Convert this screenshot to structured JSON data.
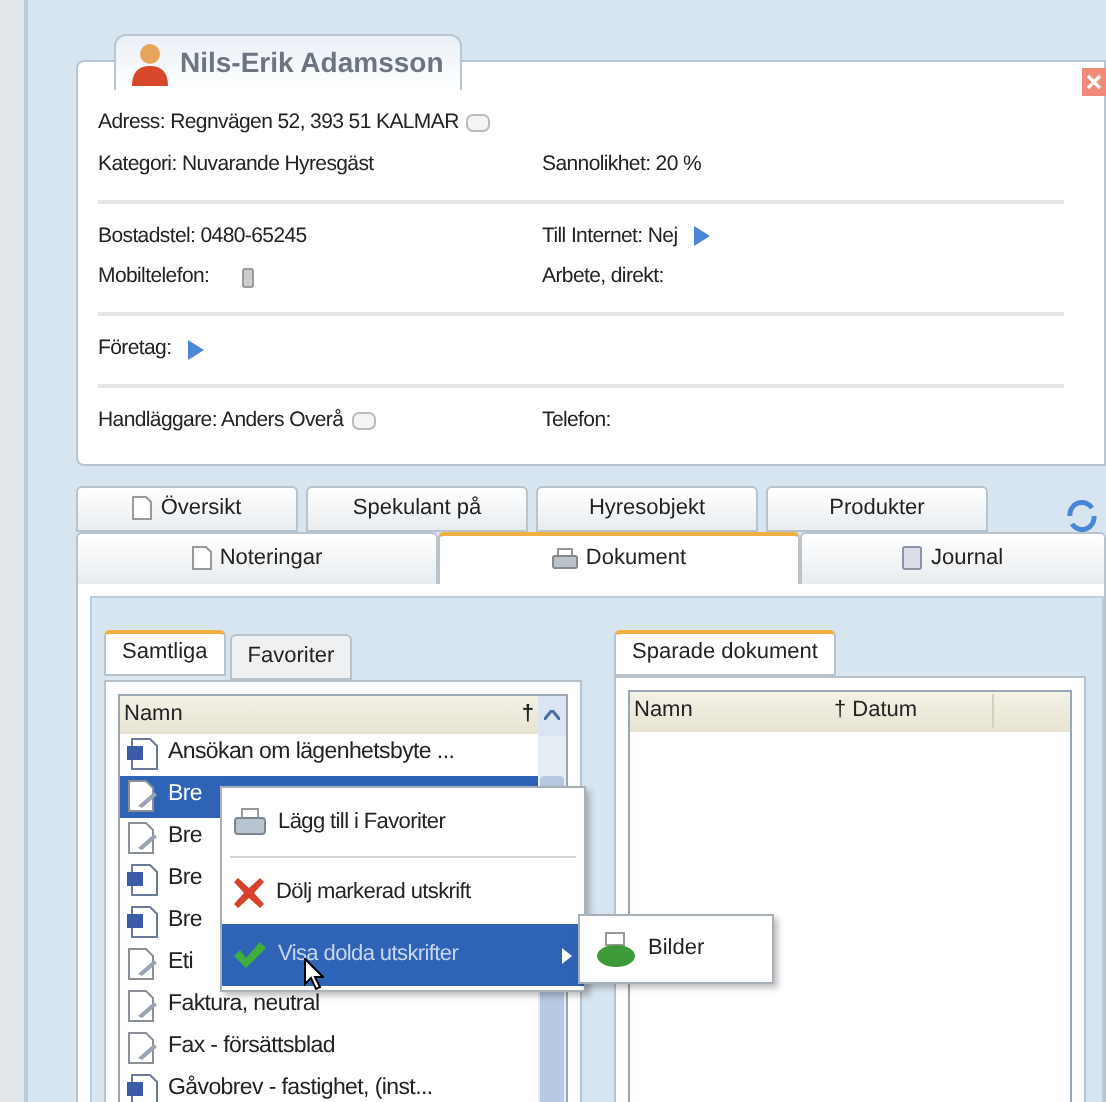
{
  "contact": {
    "name": "Nils-Erik Adamsson",
    "sections": [
      {
        "rows": [
          {
            "left": {
              "text": "Adress: Regnvägen 52, 393 51  KALMAR"
            }
          },
          {
            "left": {
              "text": "Kategori: Nuvarande Hyresgäst"
            },
            "right": {
              "text": "Sannolikhet: 20 %"
            }
          }
        ]
      },
      {
        "rows": [
          {
            "left": {
              "text": "Bostadstel: 0480-65245"
            },
            "right": {
              "text": "Till Internet: Nej"
            }
          },
          {
            "left": {
              "text": "Mobiltelefon:"
            },
            "right": {
              "text": "Arbete, direkt:"
            }
          }
        ]
      },
      {
        "rows": [
          {
            "left": {
              "text": "Företag:"
            }
          }
        ]
      },
      {
        "rows": [
          {
            "left": {
              "text": "Handläggare: Anders Overå"
            },
            "right": {
              "text": "Telefon:"
            }
          }
        ]
      }
    ]
  },
  "tabs_row_1": [
    {
      "label": "Översikt",
      "selected": false
    },
    {
      "label": "Spekulant på",
      "selected": false
    },
    {
      "label": "Hyresobjekt",
      "selected": false
    },
    {
      "label": "Produkter",
      "selected": false
    }
  ],
  "tabs_row_2": [
    {
      "label": "Noteringar",
      "selected": false
    },
    {
      "label": "Dokument",
      "selected": true
    },
    {
      "label": "Journal",
      "selected": false
    }
  ],
  "left_panel": {
    "tabs": [
      {
        "label": "Samtliga",
        "selected": true
      },
      {
        "label": "Favoriter",
        "selected": false
      }
    ],
    "columns": [
      "Namn",
      "†"
    ],
    "rows": [
      {
        "name": "Ansökan om lägenhetsbyte ...",
        "kind": "word",
        "selected": false
      },
      {
        "name": "Bre",
        "kind": "template",
        "selected": true
      },
      {
        "name": "Bre",
        "kind": "template",
        "selected": false
      },
      {
        "name": "Bre",
        "kind": "word",
        "selected": false
      },
      {
        "name": "Bre",
        "kind": "word",
        "selected": false
      },
      {
        "name": "Eti",
        "kind": "template",
        "selected": false
      },
      {
        "name": "Faktura, neutral",
        "kind": "template",
        "selected": false
      },
      {
        "name": "Fax - försättsblad",
        "kind": "template",
        "selected": false
      },
      {
        "name": "Gåvobrev - fastighet, (inst...",
        "kind": "word",
        "selected": false
      }
    ]
  },
  "right_panel": {
    "tabs": [
      {
        "label": "Sparade dokument",
        "selected": true
      }
    ],
    "columns": [
      "Namn",
      "† Datum"
    ]
  },
  "context_menu": {
    "items": [
      {
        "label": "Lägg till i Favoriter",
        "kind": "favorite",
        "selected": false,
        "has_submenu": false
      },
      {
        "label": "Dölj markerad utskrift",
        "kind": "hide",
        "selected": false,
        "has_submenu": false
      },
      {
        "label": "Visa dolda utskrifter",
        "kind": "show",
        "selected": true,
        "has_submenu": true
      }
    ],
    "submenu": [
      {
        "label": "Bilder",
        "kind": "images"
      }
    ]
  }
}
